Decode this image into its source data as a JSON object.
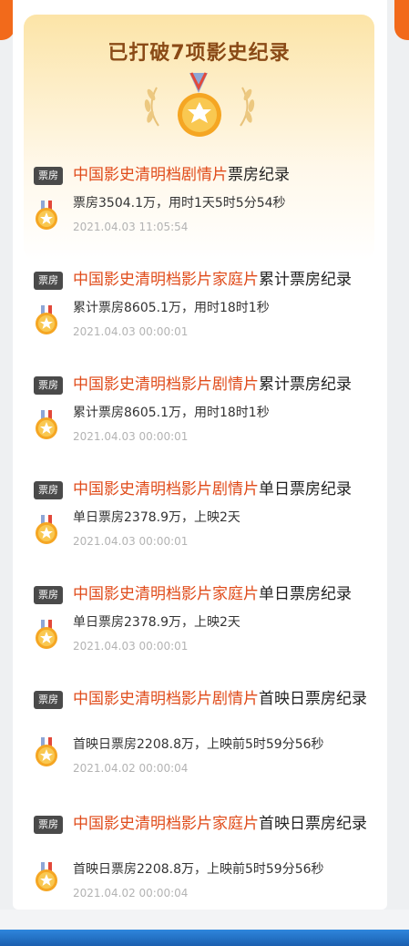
{
  "banner": {
    "title": "已打破7项影史纪录"
  },
  "tag_label": "票房",
  "records": [
    {
      "highlight": "中国影史清明档剧情片",
      "suffix": "票房纪录",
      "detail": "票房3504.1万，用时1天5时5分54秒",
      "time": "2021.04.03 11:05:54"
    },
    {
      "highlight": "中国影史清明档影片家庭片",
      "suffix": "累计票房纪录",
      "detail": "累计票房8605.1万，用时18时1秒",
      "time": "2021.04.03 00:00:01"
    },
    {
      "highlight": "中国影史清明档影片剧情片",
      "suffix": "累计票房纪录",
      "detail": "累计票房8605.1万，用时18时1秒",
      "time": "2021.04.03 00:00:01"
    },
    {
      "highlight": "中国影史清明档影片剧情片",
      "suffix": "单日票房纪录",
      "detail": "单日票房2378.9万，上映2天",
      "time": "2021.04.03 00:00:01"
    },
    {
      "highlight": "中国影史清明档影片家庭片",
      "suffix": "单日票房纪录",
      "detail": "单日票房2378.9万，上映2天",
      "time": "2021.04.03 00:00:01"
    },
    {
      "highlight": "中国影史清明档影片剧情片",
      "suffix": "首映日票房纪录",
      "detail": "首映日票房2208.8万，上映前5时59分56秒",
      "time": "2021.04.02 00:00:04"
    },
    {
      "highlight": "中国影史清明档影片家庭片",
      "suffix": "首映日票房纪录",
      "detail": "首映日票房2208.8万，上映前5时59分56秒",
      "time": "2021.04.02 00:00:04"
    }
  ],
  "colors": {
    "accent": "#e04b1a",
    "brand_orange": "#f26a1b",
    "medal_gold": "#f5b62a"
  },
  "icons": {
    "banner": "laurel-medal-icon",
    "record": "gold-medal-icon"
  }
}
